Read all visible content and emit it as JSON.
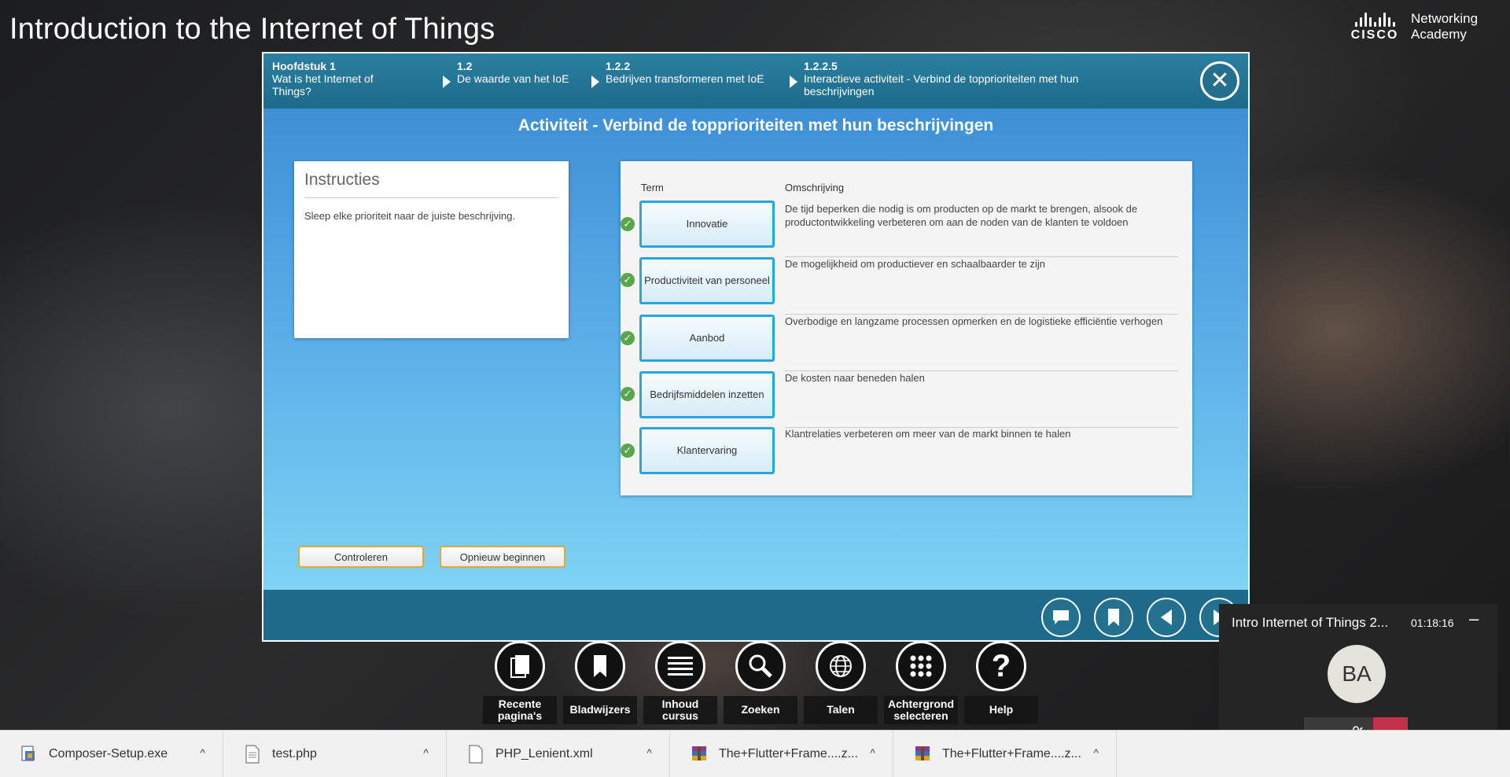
{
  "app_title": "Introduction to the Internet of Things",
  "brand": {
    "word": "CISCO",
    "line1": "Networking",
    "line2": "Academy"
  },
  "breadcrumbs": [
    {
      "num": "Hoofdstuk 1",
      "text": "Wat is het Internet of Things?"
    },
    {
      "num": "1.2",
      "text": "De waarde van het IoE"
    },
    {
      "num": "1.2.2",
      "text": "Bedrijven transformeren met IoE"
    },
    {
      "num": "1.2.2.5",
      "text": "Interactieve activiteit - Verbind de topprioriteiten met hun beschrijvingen"
    }
  ],
  "activity_title": "Activiteit - Verbind de topprioriteiten met hun beschrijvingen",
  "instructions": {
    "heading": "Instructies",
    "text": "Sleep elke prioriteit naar de juiste beschrijving."
  },
  "matching": {
    "term_header": "Term",
    "desc_header": "Omschrijving",
    "rows": [
      {
        "term": "Innovatie",
        "desc": "De tijd beperken die nodig is om producten op de markt te brengen, alsook de productontwikkeling verbeteren om aan de noden van de klanten te voldoen",
        "correct": true
      },
      {
        "term": "Productiviteit van personeel",
        "desc": "De mogelijkheid om productiever en schaalbaarder te zijn",
        "correct": true
      },
      {
        "term": "Aanbod",
        "desc": "Overbodige en langzame processen opmerken en de logistieke efficiëntie verhogen",
        "correct": true
      },
      {
        "term": "Bedrijfsmiddelen inzetten",
        "desc": "De kosten naar beneden halen",
        "correct": true
      },
      {
        "term": "Klantervaring",
        "desc": "Klantrelaties verbeteren om meer van de markt binnen te halen",
        "correct": true
      }
    ]
  },
  "buttons": {
    "check": "Controleren",
    "reset": "Opnieuw beginnen"
  },
  "toolbar": [
    {
      "icon": "pages-icon",
      "label": "Recente pagina's"
    },
    {
      "icon": "bookmark-icon",
      "label": "Bladwijzers"
    },
    {
      "icon": "menu-icon",
      "label": "Inhoud cursus"
    },
    {
      "icon": "search-icon",
      "label": "Zoeken"
    },
    {
      "icon": "globe-icon",
      "label": "Talen"
    },
    {
      "icon": "grid-icon",
      "label": "Achtergrond selecteren"
    },
    {
      "icon": "help-icon",
      "label": "Help"
    }
  ],
  "call": {
    "title": "Intro Internet of Things 2...",
    "time": "01:18:16",
    "avatar": "BA",
    "end_color": "#c4314b"
  },
  "downloads": [
    {
      "name": "Composer-Setup.exe"
    },
    {
      "name": "test.php"
    },
    {
      "name": "PHP_Lenient.xml"
    },
    {
      "name": "The+Flutter+Frame....z..."
    },
    {
      "name": "The+Flutter+Frame....z..."
    }
  ],
  "colors": {
    "accent": "#1d6a8b",
    "term_border": "#26a6de",
    "check_green": "#5aa64a",
    "button_border": "#e9a436"
  }
}
